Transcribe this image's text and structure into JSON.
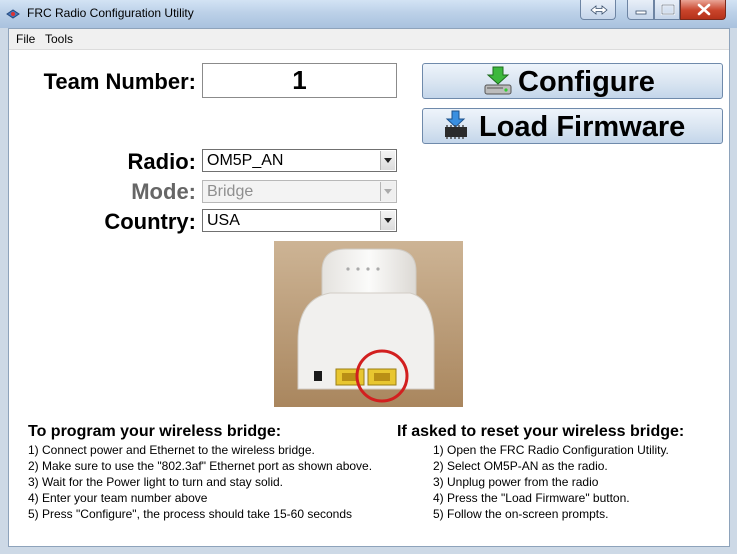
{
  "window": {
    "title": "FRC Radio Configuration Utility"
  },
  "menu": {
    "file": "File",
    "tools": "Tools"
  },
  "team": {
    "label": "Team Number:",
    "value": "1"
  },
  "buttons": {
    "configure": "Configure",
    "load_firmware": "Load Firmware"
  },
  "radio": {
    "label": "Radio:",
    "selected": "OM5P_AN"
  },
  "mode": {
    "label": "Mode:",
    "selected": "Bridge"
  },
  "country": {
    "label": "Country:",
    "selected": "USA"
  },
  "program": {
    "heading": "To program your wireless bridge:",
    "steps": [
      "1) Connect power and Ethernet to the wireless bridge.",
      "2) Make sure to use the \"802.3af\" Ethernet port as shown above.",
      "3) Wait for the Power light to turn and stay solid.",
      "4) Enter your team number above",
      "5) Press \"Configure\", the process should take 15-60 seconds"
    ]
  },
  "reset": {
    "heading": "If asked to reset your wireless bridge:",
    "steps": [
      "1) Open the FRC Radio Configuration Utility.",
      "2) Select OM5P-AN as the radio.",
      "3) Unplug power from the radio",
      "4) Press the \"Load Firmware\" button.",
      "5) Follow the on-screen prompts."
    ]
  },
  "icons": {
    "configure": "green-arrow-drive-icon",
    "load_firmware": "blue-arrow-chip-icon",
    "window_extra": "resize-arrows-icon",
    "minimize": "minimize-icon",
    "maximize": "maximize-icon",
    "close": "close-icon"
  },
  "colors": {
    "titlebar": "#bcd1e8",
    "close_button": "#c9442b",
    "highlight_circle": "#d21f1f"
  }
}
